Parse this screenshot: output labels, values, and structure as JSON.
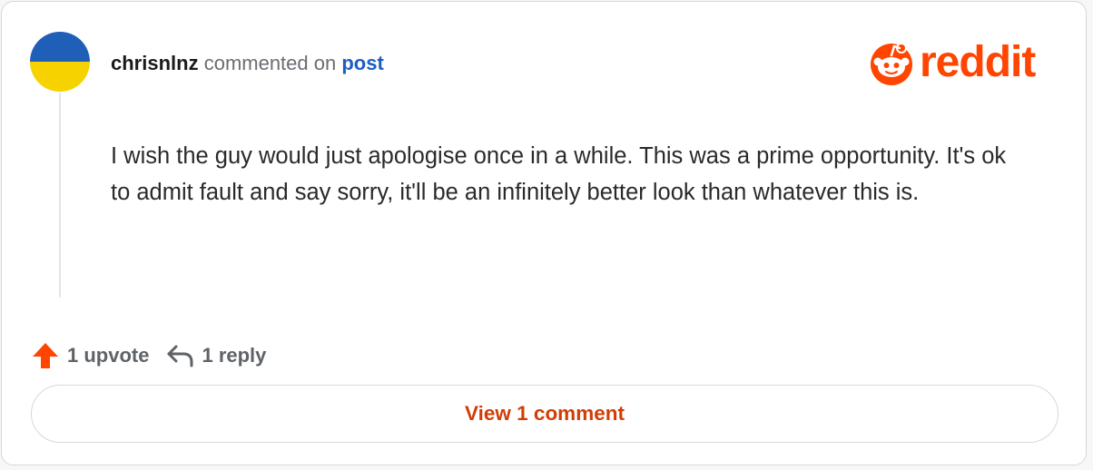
{
  "comment": {
    "author": "chrisnlnz",
    "action_text": "commented on",
    "post_link_label": "post",
    "body": "I wish the guy would just apologise once in a while. This was a prime opportunity. It's ok to admit fault and say sorry, it'll be an infinitely better look than whatever this is."
  },
  "brand": {
    "wordmark": "reddit",
    "color": "#ff4500"
  },
  "avatar": {
    "colors": [
      "#1f5fb8",
      "#f5d200"
    ]
  },
  "actions": {
    "upvote_label": "1 upvote",
    "reply_label": "1 reply",
    "upvote_icon": "upvote-arrow-icon",
    "reply_icon": "reply-arrow-icon"
  },
  "footer": {
    "view_comments_label": "View 1 comment"
  }
}
